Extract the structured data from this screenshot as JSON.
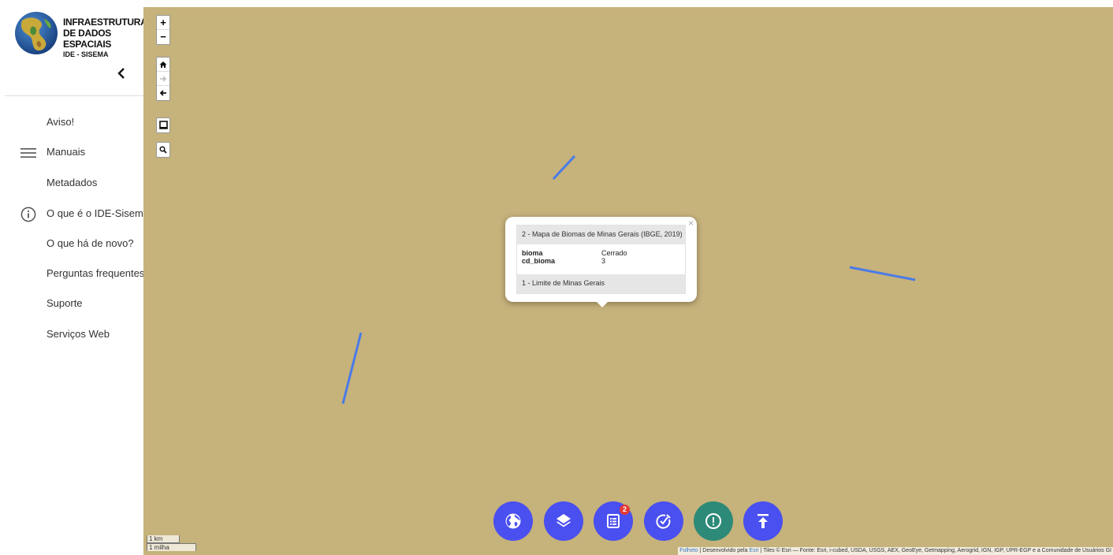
{
  "logo": {
    "line1": "INFRAESTRUTURA",
    "line2": "DE DADOS ESPACIAIS",
    "line3": "IDE - SISEMA"
  },
  "sidebar": {
    "collapse_icon": "chevron-left-icon",
    "items": [
      {
        "label": "Aviso!",
        "icon": null
      },
      {
        "label": "Manuais",
        "icon": "hamburger-icon"
      },
      {
        "label": "Metadados",
        "icon": null
      },
      {
        "label": "O que é o IDE-Sisema",
        "icon": "info-icon"
      },
      {
        "label": "O que há de novo?",
        "icon": null
      },
      {
        "label": "Perguntas frequentes",
        "icon": null
      },
      {
        "label": "Suporte",
        "icon": null
      },
      {
        "label": "Serviços Web",
        "icon": null
      }
    ]
  },
  "map_controls": {
    "zoom_in": "+",
    "zoom_out": "−",
    "home_icon": "home-icon",
    "forward_icon": "arrow-right-icon",
    "back_icon": "arrow-left-icon",
    "select_icon": "box-select-icon",
    "search_icon": "magnifier-icon"
  },
  "popup": {
    "close": "×",
    "layer_title": "2 - Mapa de Biomas de Minas Gerais (IBGE, 2019)",
    "attributes": [
      {
        "key": "bioma",
        "value": "Cerrado"
      },
      {
        "key": "cd_bioma",
        "value": "3"
      }
    ],
    "other_layer": "1 - Limite de Minas Gerais"
  },
  "bottom_buttons": [
    {
      "icon": "globe-icon",
      "color": "#4a4ff0"
    },
    {
      "icon": "layers-icon",
      "color": "#4a4ff0"
    },
    {
      "icon": "list-icon",
      "color": "#4a4ff0",
      "badge": "2"
    },
    {
      "icon": "edit-check-icon",
      "color": "#4a4ff0"
    },
    {
      "icon": "alert-icon",
      "color": "#2d8a78"
    },
    {
      "icon": "upload-icon",
      "color": "#4a4ff0"
    }
  ],
  "scale": {
    "km": "1 km",
    "mile": "1 milha"
  },
  "attribution": {
    "leaflet": "Folheto",
    "dev_text": " | Desenvolvido pela ",
    "esri": "Esri",
    "tiles": " | Tiles © Esri — Fonte: Esri, i-cubed, USDA, USGS, AEX, GeoEye, Getmapping, Aerogrid, IGN, IGP, UPR-EGP e a Comunidade de Usuários GI"
  },
  "colors": {
    "map_background": "#c6b27b",
    "boundary_line": "#4a7be8",
    "fab_primary": "#4a4ff0",
    "fab_teal": "#2d8a78",
    "badge": "#e53935"
  }
}
